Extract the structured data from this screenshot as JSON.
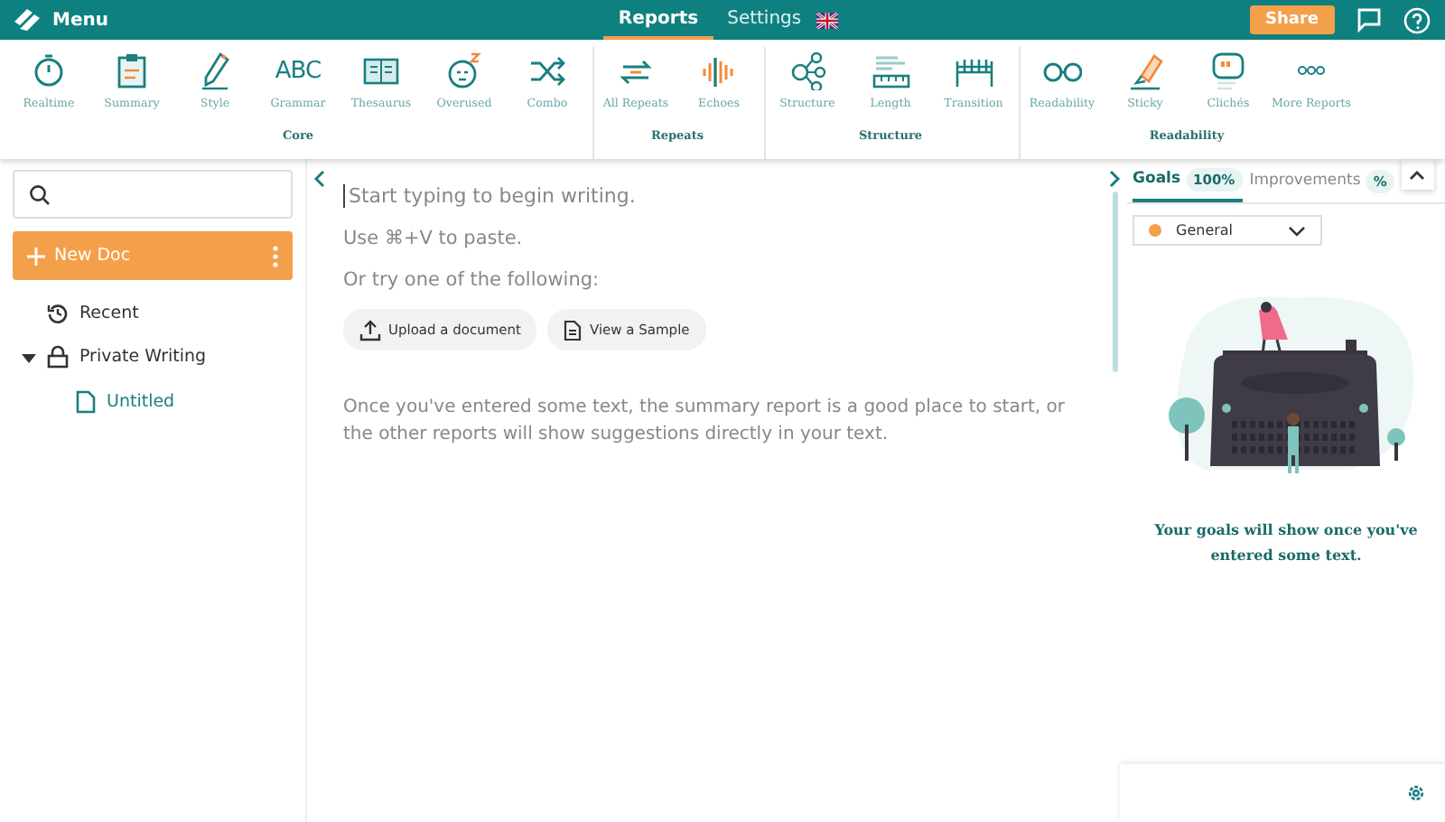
{
  "topbar": {
    "menu_label": "Menu",
    "tabs": [
      {
        "label": "Reports",
        "selected": true
      },
      {
        "label": "Settings",
        "selected": false
      }
    ],
    "share_label": "Share"
  },
  "toolbar": {
    "groups": [
      {
        "label": "Core",
        "items": [
          {
            "label": "Realtime"
          },
          {
            "label": "Summary"
          },
          {
            "label": "Style"
          },
          {
            "label": "Grammar",
            "icon_text": "ABC"
          },
          {
            "label": "Thesaurus"
          },
          {
            "label": "Overused"
          },
          {
            "label": "Combo"
          }
        ]
      },
      {
        "label": "Repeats",
        "items": [
          {
            "label": "All Repeats"
          },
          {
            "label": "Echoes"
          }
        ]
      },
      {
        "label": "Structure",
        "items": [
          {
            "label": "Structure"
          },
          {
            "label": "Length"
          },
          {
            "label": "Transition"
          }
        ]
      },
      {
        "label": "Readability",
        "items": [
          {
            "label": "Readability"
          },
          {
            "label": "Sticky"
          },
          {
            "label": "Clichés"
          },
          {
            "label": "More Reports"
          }
        ]
      }
    ]
  },
  "sidebar": {
    "new_doc_label": "New Doc",
    "tree": [
      {
        "label": "Recent",
        "kind": "recent"
      },
      {
        "label": "Private Writing",
        "kind": "folder",
        "expanded": true,
        "children": [
          {
            "label": "Untitled",
            "kind": "doc",
            "selected": true
          }
        ]
      }
    ]
  },
  "editor": {
    "placeholder": "Start typing to begin writing.",
    "hints": [
      "Use ⌘+V to paste.",
      "Or try one of the following:"
    ],
    "buttons": [
      {
        "label": "Upload a document",
        "kind": "upload"
      },
      {
        "label": "View a Sample",
        "kind": "sample"
      }
    ],
    "note": "Once you've entered some text, the summary report is a good place to start, or the other reports will show suggestions directly in your text."
  },
  "panel": {
    "tabs": [
      {
        "label": "Goals",
        "badge": "100%",
        "selected": true
      },
      {
        "label": "Improvements",
        "badge": "%",
        "selected": false
      }
    ],
    "goal_select": {
      "value": "General",
      "color": "#f4a04a"
    },
    "message": "Your goals will show once you've entered some text."
  }
}
